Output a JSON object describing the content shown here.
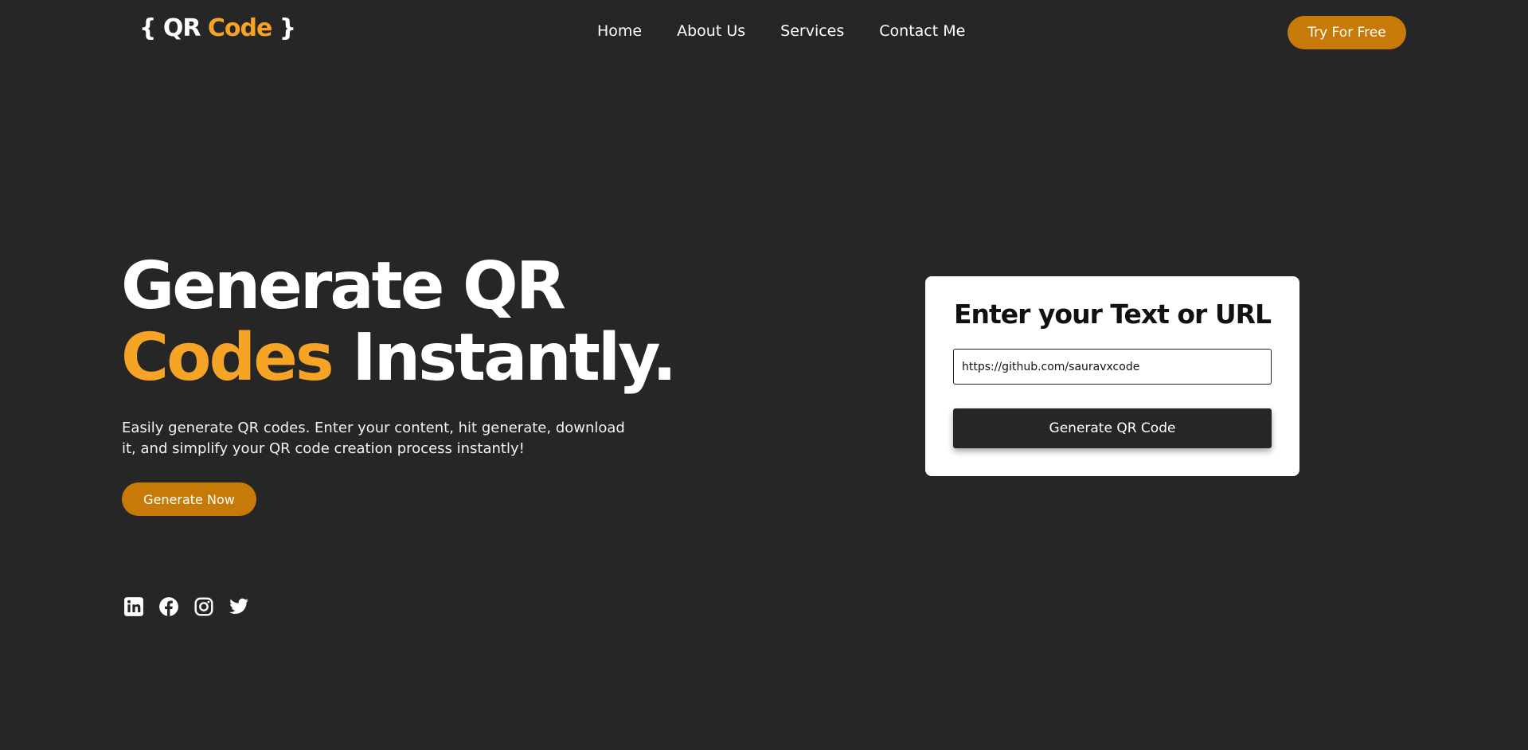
{
  "header": {
    "logo": {
      "open": "{ ",
      "part1": "QR",
      "part2": "Code",
      "close": " }"
    },
    "nav": [
      "Home",
      "About Us",
      "Services",
      "Contact Me"
    ],
    "cta_label": "Try For Free"
  },
  "hero": {
    "line1": "Generate QR",
    "line2_accent": "Codes",
    "line2_rest": " Instantly.",
    "description": "Easily generate QR codes. Enter your content, hit generate, download it, and simplify your QR code creation process instantly!",
    "button_label": "Generate Now",
    "socials": [
      "linkedin-icon",
      "facebook-icon",
      "instagram-icon",
      "twitter-icon"
    ]
  },
  "card": {
    "title": "Enter your Text or URL",
    "input_value": "https://github.com/sauravxcode",
    "button_label": "Generate QR Code"
  },
  "colors": {
    "background": "#262626",
    "accent": "#f7a325",
    "button": "#c87a08",
    "card": "#ffffff"
  }
}
